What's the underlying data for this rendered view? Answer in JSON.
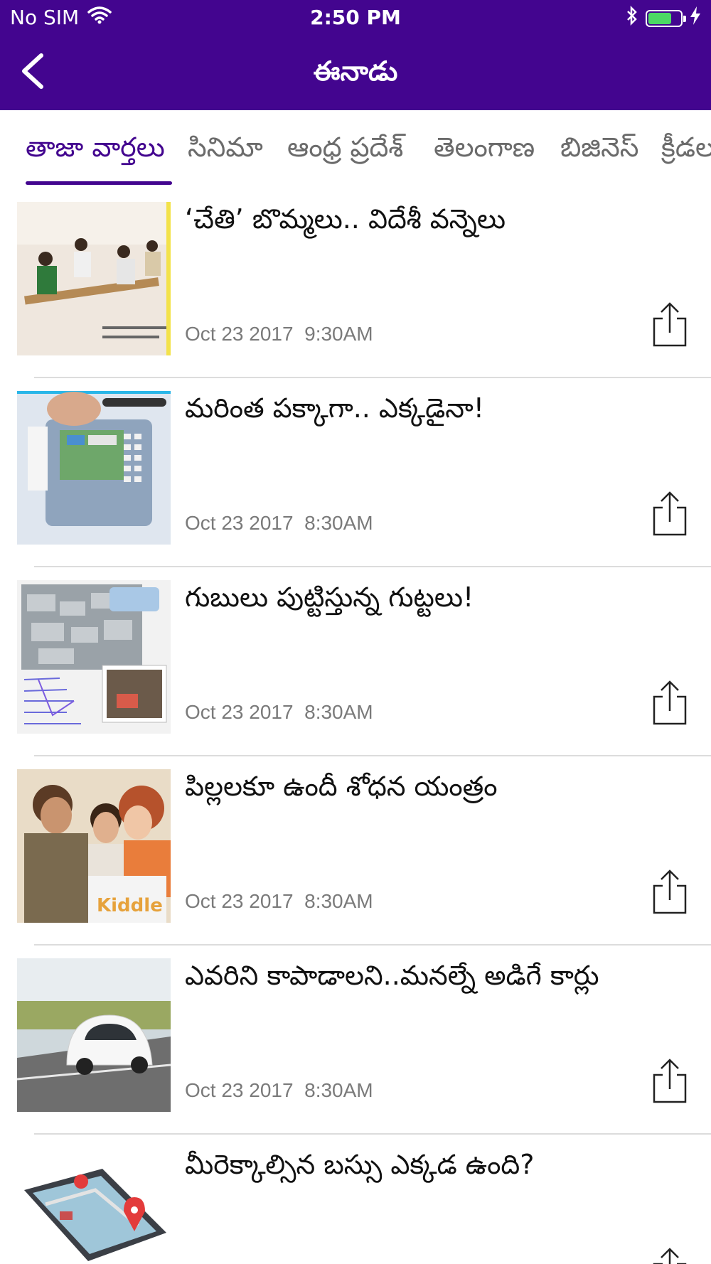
{
  "status_bar": {
    "carrier": "No SIM",
    "time": "2:50 PM",
    "battery_level": 0.72,
    "battery_color": "#4cd964"
  },
  "nav": {
    "title": "ఈనాడు",
    "back_icon": "chevron-left-icon"
  },
  "colors": {
    "brand": "#43058f",
    "text": "#111111",
    "muted": "#7a7a7a"
  },
  "tabs": [
    {
      "label": "తాజా వార్తలు",
      "active": true
    },
    {
      "label": "సినిమా",
      "active": false
    },
    {
      "label": "ఆంధ్ర ప్రదేశ్",
      "active": false
    },
    {
      "label": "తెలంగాణ",
      "active": false
    },
    {
      "label": "బిజినెస్",
      "active": false
    },
    {
      "label": "క్రీడలు",
      "active": false
    }
  ],
  "articles": [
    {
      "headline": "‘చేతి’ బొమ్మలు.. విదేశీ వన్నెలు",
      "date": "Oct 23 2017",
      "time": "9:30AM"
    },
    {
      "headline": "మరింత పక్కాగా.. ఎక్కడైనా!",
      "date": "Oct 23 2017",
      "time": "8:30AM"
    },
    {
      "headline": "గుబులు పుట్టిస్తున్న గుట్టలు!",
      "date": "Oct 23 2017",
      "time": "8:30AM"
    },
    {
      "headline": "పిల్లలకూ ఉందీ శోధన యంత్రం",
      "date": "Oct 23 2017",
      "time": "8:30AM"
    },
    {
      "headline": "ఎవరిని కాపాడాలని..మనల్నే అడిగే కార్లు",
      "date": "Oct 23 2017",
      "time": "8:30AM"
    },
    {
      "headline": "మీరెక్కాల్సిన బస్సు ఎక్కడ ఉంది?",
      "date": "",
      "time": ""
    }
  ]
}
